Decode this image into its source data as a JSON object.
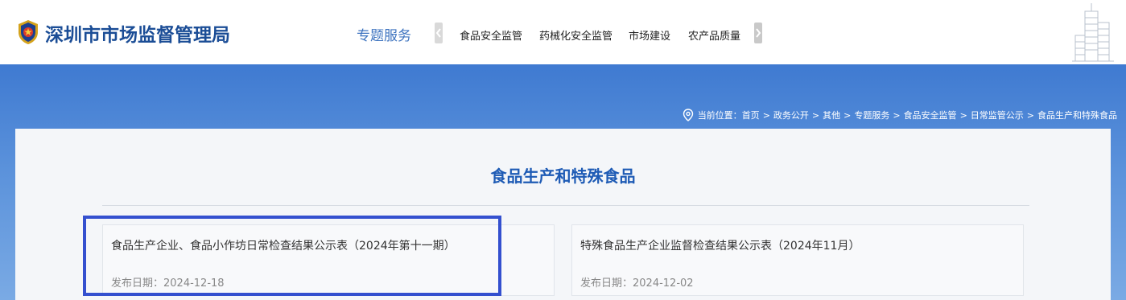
{
  "header": {
    "site_title": "深圳市市场监督管理局",
    "topic_label": "专题服务",
    "nav_items": [
      "食品安全监管",
      "药械化安全监管",
      "市场建设",
      "农产品质量"
    ],
    "icons": {
      "logo": "police-emblem-icon",
      "prev": "chevron-left-icon",
      "next": "chevron-right-icon",
      "building": "building-illustration"
    }
  },
  "breadcrumb": {
    "prefix": "当前位置：",
    "items": [
      "首页",
      "政务公开",
      "其他",
      "专题服务",
      "食品安全监管",
      "日常监管公示",
      "食品生产和特殊食品"
    ],
    "separator": ">"
  },
  "main": {
    "page_title": "食品生产和特殊食品",
    "cards": [
      {
        "title": "食品生产企业、食品小作坊日常检查结果公示表（2024年第十一期）",
        "date_label": "发布日期：",
        "date": "2024-12-18"
      },
      {
        "title": "特殊食品生产企业监督检查结果公示表（2024年11月）",
        "date_label": "发布日期：",
        "date": "2024-12-02"
      }
    ]
  },
  "colors": {
    "brand": "#1b4d96",
    "banner": "#4a84d6",
    "highlight": "#3450cf"
  }
}
